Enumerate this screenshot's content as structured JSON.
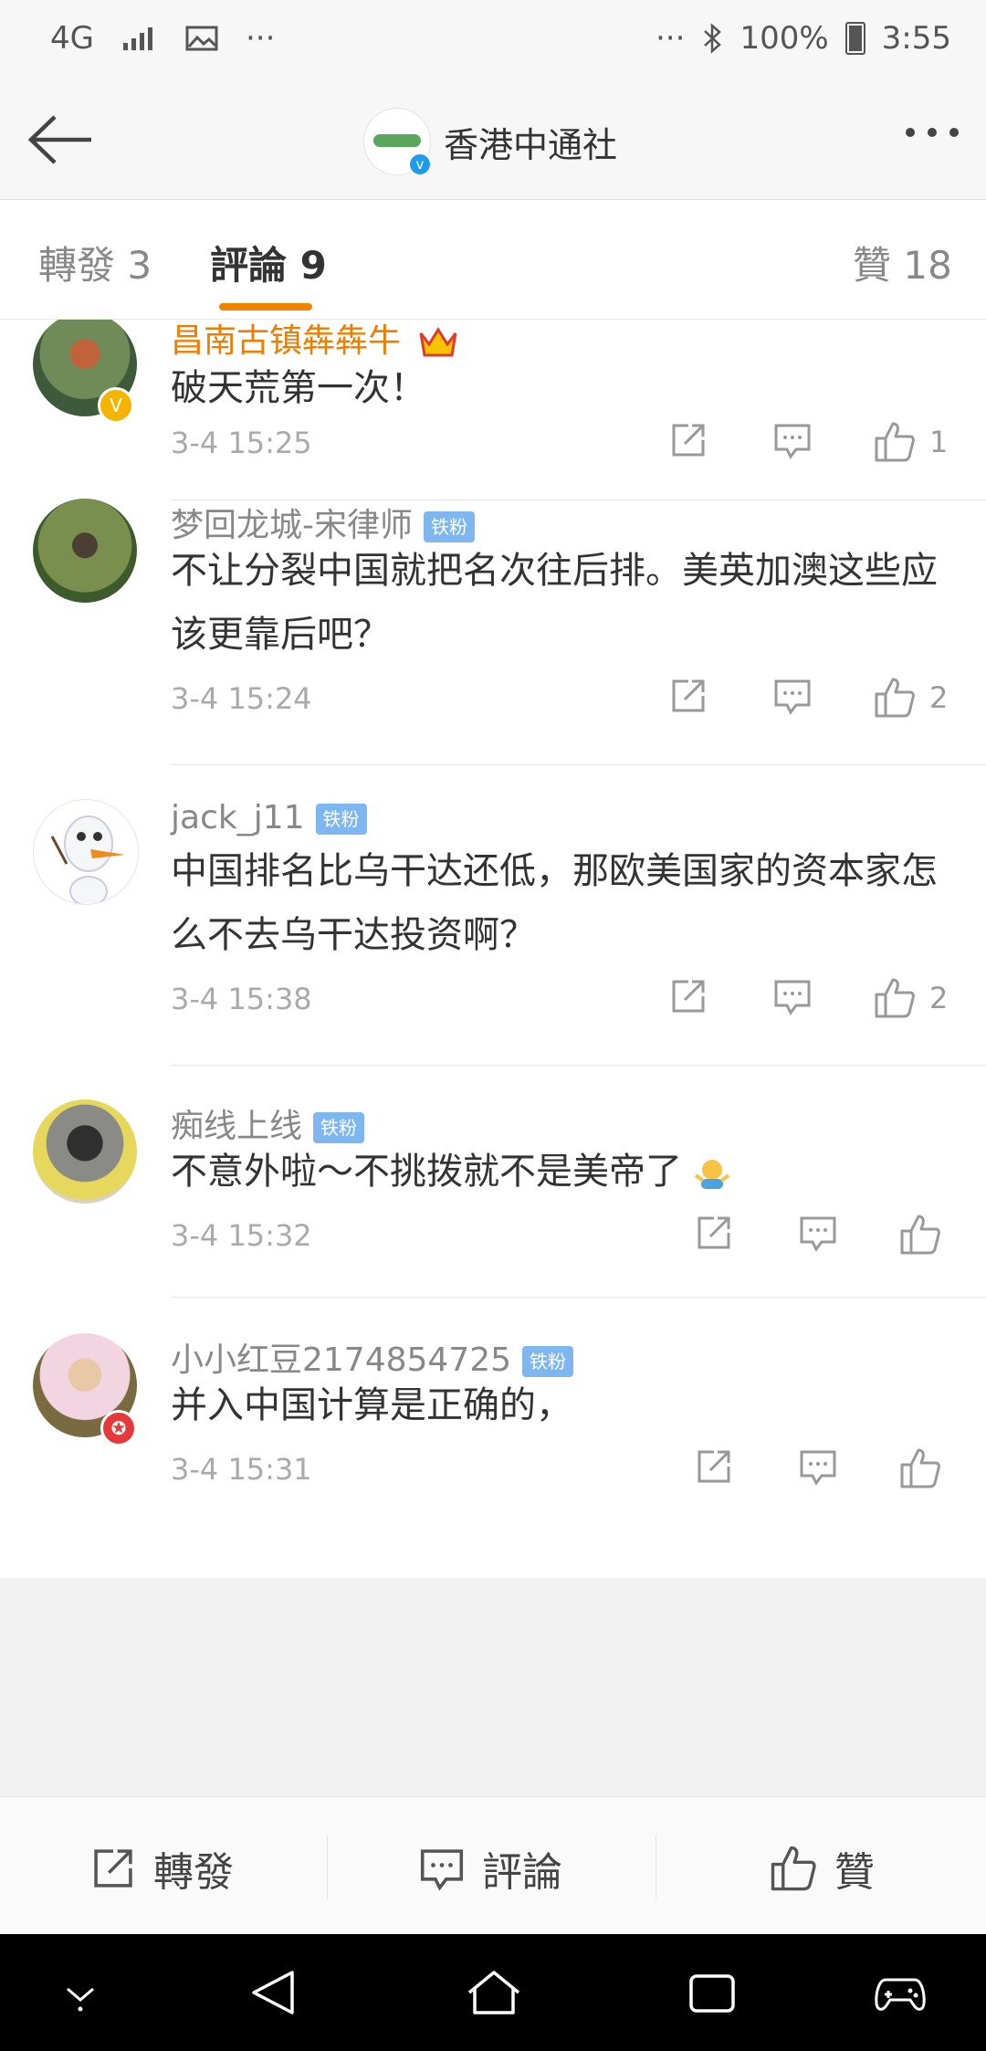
{
  "status_bar": {
    "network": "4G",
    "dots": "···",
    "battery": "100%",
    "time": "3:55"
  },
  "header": {
    "title": "香港中通社",
    "verified_mark": "v",
    "icons": [
      "back-arrow-icon",
      "more-icon"
    ]
  },
  "tabs": [
    {
      "label": "轉發 3"
    },
    {
      "label": "評論 9"
    },
    {
      "label": "贊 18"
    }
  ],
  "colors": {
    "accent": "#f08300",
    "verified_blue": "#1e9be9",
    "tag_blue": "#7eb7ef"
  },
  "comments": [
    {
      "user": "昌南古镇犇犇牛",
      "text": "破天荒第一次！",
      "time": "3-4 15:25",
      "likes": "1",
      "badge": "V"
    },
    {
      "user": "梦回龙城-宋律师",
      "tag": "铁粉",
      "text": "不让分裂中国就把名次往后排。美英加澳这些应该更靠后吧？",
      "time": "3-4 15:24",
      "likes": "2"
    },
    {
      "user": "jack_j11",
      "tag": "铁粉",
      "text": "中国排名比乌干达还低，那欧美国家的资本家怎么不去乌干达投资啊？",
      "time": "3-4 15:38",
      "likes": "2"
    },
    {
      "user": "痴线上线",
      "tag": "铁粉",
      "text": "不意外啦～不挑拨就不是美帝了",
      "time": "3-4 15:32",
      "likes": ""
    },
    {
      "user": "小小红豆2174854725",
      "tag": "铁粉",
      "text": "并入中国计算是正确的，",
      "time": "3-4 15:31",
      "likes": "",
      "badge": "✪"
    }
  ],
  "footer": {
    "repost": "轉發",
    "comment": "評論",
    "like": "贊"
  }
}
